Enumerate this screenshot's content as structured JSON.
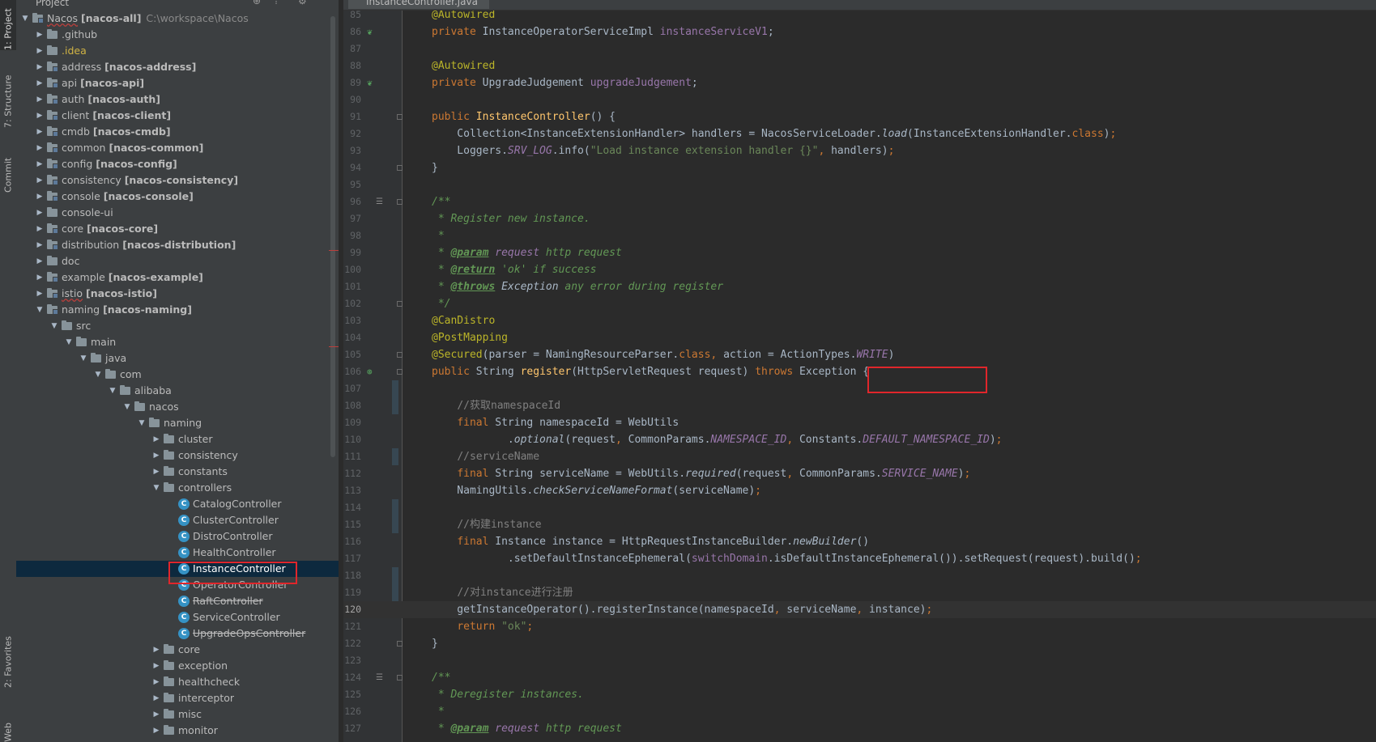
{
  "tool_window_tabs": [
    {
      "label": "1: Project"
    },
    {
      "label": "7: Structure"
    },
    {
      "label": "Commit"
    },
    {
      "label": "2: Favorites"
    },
    {
      "label": "Web"
    }
  ],
  "project_panel": {
    "title": "Project",
    "tree": [
      {
        "depth": 0,
        "expanded": true,
        "icon": "module",
        "label": "Nacos",
        "module": "[nacos-all]",
        "path": "C:\\workspace\\Nacos",
        "wavy": true
      },
      {
        "depth": 1,
        "expanded": false,
        "icon": "folder",
        "label": ".github"
      },
      {
        "depth": 1,
        "expanded": false,
        "icon": "folder",
        "label": ".idea",
        "style": "yellow"
      },
      {
        "depth": 1,
        "expanded": false,
        "icon": "module",
        "label": "address",
        "module": "[nacos-address]"
      },
      {
        "depth": 1,
        "expanded": false,
        "icon": "module",
        "label": "api",
        "module": "[nacos-api]"
      },
      {
        "depth": 1,
        "expanded": false,
        "icon": "module",
        "label": "auth",
        "module": "[nacos-auth]"
      },
      {
        "depth": 1,
        "expanded": false,
        "icon": "module",
        "label": "client",
        "module": "[nacos-client]"
      },
      {
        "depth": 1,
        "expanded": false,
        "icon": "module",
        "label": "cmdb",
        "module": "[nacos-cmdb]"
      },
      {
        "depth": 1,
        "expanded": false,
        "icon": "module",
        "label": "common",
        "module": "[nacos-common]"
      },
      {
        "depth": 1,
        "expanded": false,
        "icon": "module",
        "label": "config",
        "module": "[nacos-config]"
      },
      {
        "depth": 1,
        "expanded": false,
        "icon": "module",
        "label": "consistency",
        "module": "[nacos-consistency]"
      },
      {
        "depth": 1,
        "expanded": false,
        "icon": "module",
        "label": "console",
        "module": "[nacos-console]"
      },
      {
        "depth": 1,
        "expanded": false,
        "icon": "folder",
        "label": "console-ui"
      },
      {
        "depth": 1,
        "expanded": false,
        "icon": "module",
        "label": "core",
        "module": "[nacos-core]"
      },
      {
        "depth": 1,
        "expanded": false,
        "icon": "module",
        "label": "distribution",
        "module": "[nacos-distribution]"
      },
      {
        "depth": 1,
        "expanded": false,
        "icon": "folder",
        "label": "doc"
      },
      {
        "depth": 1,
        "expanded": false,
        "icon": "module",
        "label": "example",
        "module": "[nacos-example]"
      },
      {
        "depth": 1,
        "expanded": false,
        "icon": "module",
        "label": "istio",
        "module": "[nacos-istio]",
        "wavy": true
      },
      {
        "depth": 1,
        "expanded": true,
        "icon": "module",
        "label": "naming",
        "module": "[nacos-naming]"
      },
      {
        "depth": 2,
        "expanded": true,
        "icon": "folder",
        "label": "src"
      },
      {
        "depth": 3,
        "expanded": true,
        "icon": "folder",
        "label": "main"
      },
      {
        "depth": 4,
        "expanded": true,
        "icon": "folder",
        "label": "java"
      },
      {
        "depth": 5,
        "expanded": true,
        "icon": "folder",
        "label": "com"
      },
      {
        "depth": 6,
        "expanded": true,
        "icon": "folder",
        "label": "alibaba"
      },
      {
        "depth": 7,
        "expanded": true,
        "icon": "folder",
        "label": "nacos"
      },
      {
        "depth": 8,
        "expanded": true,
        "icon": "folder",
        "label": "naming"
      },
      {
        "depth": 9,
        "expanded": false,
        "icon": "folder",
        "label": "cluster"
      },
      {
        "depth": 9,
        "expanded": false,
        "icon": "folder",
        "label": "consistency"
      },
      {
        "depth": 9,
        "expanded": false,
        "icon": "folder",
        "label": "constants"
      },
      {
        "depth": 9,
        "expanded": true,
        "icon": "folder",
        "label": "controllers"
      },
      {
        "depth": 10,
        "icon": "class",
        "label": "CatalogController"
      },
      {
        "depth": 10,
        "icon": "class",
        "label": "ClusterController"
      },
      {
        "depth": 10,
        "icon": "class",
        "label": "DistroController"
      },
      {
        "depth": 10,
        "icon": "class",
        "label": "HealthController"
      },
      {
        "depth": 10,
        "icon": "class",
        "label": "InstanceController",
        "selected": true
      },
      {
        "depth": 10,
        "icon": "class",
        "label": "OperatorController"
      },
      {
        "depth": 10,
        "icon": "class",
        "label": "RaftController",
        "style": "strike"
      },
      {
        "depth": 10,
        "icon": "class",
        "label": "ServiceController"
      },
      {
        "depth": 10,
        "icon": "class",
        "label": "UpgradeOpsController",
        "style": "strike"
      },
      {
        "depth": 9,
        "expanded": false,
        "icon": "folder",
        "label": "core"
      },
      {
        "depth": 9,
        "expanded": false,
        "icon": "folder",
        "label": "exception"
      },
      {
        "depth": 9,
        "expanded": false,
        "icon": "folder",
        "label": "healthcheck"
      },
      {
        "depth": 9,
        "expanded": false,
        "icon": "folder",
        "label": "interceptor"
      },
      {
        "depth": 9,
        "expanded": false,
        "icon": "folder",
        "label": "misc"
      },
      {
        "depth": 9,
        "expanded": false,
        "icon": "folder",
        "label": "monitor"
      }
    ]
  },
  "editor": {
    "tab_label": "InstanceController.java",
    "current_line": 120,
    "lines": [
      {
        "n": 85,
        "html": "<span class='ann'>@Autowired</span>"
      },
      {
        "n": 86,
        "gi": "bean",
        "html": "<span class='kw'>private </span>InstanceOperatorServiceImpl <span class='fld'>instanceServiceV1</span>;"
      },
      {
        "n": 87,
        "html": ""
      },
      {
        "n": 88,
        "html": "<span class='ann'>@Autowired</span>"
      },
      {
        "n": 89,
        "gi": "bean",
        "html": "<span class='kw'>private </span>UpgradeJudgement <span class='fld'>upgradeJudgement</span>;"
      },
      {
        "n": 90,
        "html": ""
      },
      {
        "n": 91,
        "fold": true,
        "html": "<span class='kw'>public </span><span class='fn'>InstanceController</span>() {"
      },
      {
        "n": 92,
        "html": "    Collection&lt;InstanceExtensionHandler&gt; handlers = NacosServiceLoader.<span class='it'>load</span>(InstanceExtensionHandler.<span class='kw'>class</span>)<span class='kw'>;</span>"
      },
      {
        "n": 93,
        "html": "    Loggers.<span class='st'>SRV_LOG</span>.info(<span class='str'>\"Load instance extension handler {}\"</span><span class='kw'>, </span>handlers)<span class='kw'>;</span>"
      },
      {
        "n": 94,
        "fold": true,
        "html": "}"
      },
      {
        "n": 95,
        "html": ""
      },
      {
        "n": 96,
        "fold": true,
        "doc": true,
        "html": "<span class='jd'>/**</span>"
      },
      {
        "n": 97,
        "html": "<span class='jd'> * Register new instance.</span>"
      },
      {
        "n": 98,
        "html": "<span class='jd'> *</span>"
      },
      {
        "n": 99,
        "html": "<span class='jd'> * </span><span class='jdt'>@param</span><span class='jd'> </span><span class='fld it'>request</span><span class='jd'> http request</span>"
      },
      {
        "n": 100,
        "html": "<span class='jd'> * </span><span class='jdt'>@return</span><span class='jd'> 'ok' if success</span>"
      },
      {
        "n": 101,
        "html": "<span class='jd'> * </span><span class='jdt'>@throws</span><span class='jd'> </span><span class='it'>Exception</span><span class='jd'> any error during register</span>"
      },
      {
        "n": 102,
        "fold": true,
        "html": "<span class='jd'> */</span>"
      },
      {
        "n": 103,
        "html": "<span class='ann'>@CanDistro</span>"
      },
      {
        "n": 104,
        "html": "<span class='ann'>@PostMapping</span>"
      },
      {
        "n": 105,
        "fold": true,
        "html": "<span class='ann'>@Secured</span>(parser = NamingResourceParser.<span class='kw'>class, </span>action = ActionTypes.<span class='st'>WRITE</span>)"
      },
      {
        "n": 106,
        "gi": "web",
        "fold": true,
        "html": "<span class='kw'>public </span>String <span class='fn'>register</span>(HttpServletRequest request) <span class='kw'>throws </span>Exception {"
      },
      {
        "n": 107,
        "chg": true,
        "html": ""
      },
      {
        "n": 108,
        "chg": true,
        "html": "    <span class='cm'>//获取namespaceId</span>"
      },
      {
        "n": 109,
        "html": "    <span class='kw'>final </span>String namespaceId = WebUtils"
      },
      {
        "n": 110,
        "html": "            .<span class='it'>optional</span>(request<span class='kw'>, </span>CommonParams.<span class='st'>NAMESPACE_ID</span><span class='kw'>, </span>Constants.<span class='st'>DEFAULT_NAMESPACE_ID</span>)<span class='kw'>;</span>"
      },
      {
        "n": 111,
        "chg": true,
        "html": "    <span class='cm'>//serviceName</span>"
      },
      {
        "n": 112,
        "html": "    <span class='kw'>final </span>String serviceName = WebUtils.<span class='it'>required</span>(request<span class='kw'>, </span>CommonParams.<span class='st'>SERVICE_NAME</span>)<span class='kw'>;</span>"
      },
      {
        "n": 113,
        "html": "    NamingUtils.<span class='it'>checkServiceNameFormat</span>(serviceName)<span class='kw'>;</span>"
      },
      {
        "n": 114,
        "chg": true,
        "html": ""
      },
      {
        "n": 115,
        "chg": true,
        "html": "    <span class='cm'>//构建instance</span>"
      },
      {
        "n": 116,
        "html": "    <span class='kw'>final </span>Instance instance = HttpRequestInstanceBuilder.<span class='it'>newBuilder</span>()"
      },
      {
        "n": 117,
        "html": "            .setDefaultInstanceEphemeral(<span class='fld'>switchDomain</span>.isDefaultInstanceEphemeral()).setRequest(request).build()<span class='kw'>;</span>"
      },
      {
        "n": 118,
        "chg": true,
        "html": ""
      },
      {
        "n": 119,
        "chg": true,
        "html": "    <span class='cm'>//对instance进行注册</span>"
      },
      {
        "n": 120,
        "html": "    getInstanceOperator().registerInstance(namespaceId<span class='kw'>, </span>serviceName<span class='kw'>, </span>instance)<span class='kw'>;</span>"
      },
      {
        "n": 121,
        "html": "    <span class='kw'>return </span><span class='str'>\"ok\"</span><span class='kw'>;</span>"
      },
      {
        "n": 122,
        "fold": true,
        "html": "}"
      },
      {
        "n": 123,
        "html": ""
      },
      {
        "n": 124,
        "fold": true,
        "doc": true,
        "html": "<span class='jd'>/**</span>"
      },
      {
        "n": 125,
        "html": "<span class='jd'> * Deregister instances.</span>"
      },
      {
        "n": 126,
        "html": "<span class='jd'> *</span>"
      },
      {
        "n": 127,
        "html": "<span class='jd'> * </span><span class='jdt'>@param</span><span class='jd'> </span><span class='fld it'>request</span><span class='jd'> http request</span>"
      }
    ]
  }
}
